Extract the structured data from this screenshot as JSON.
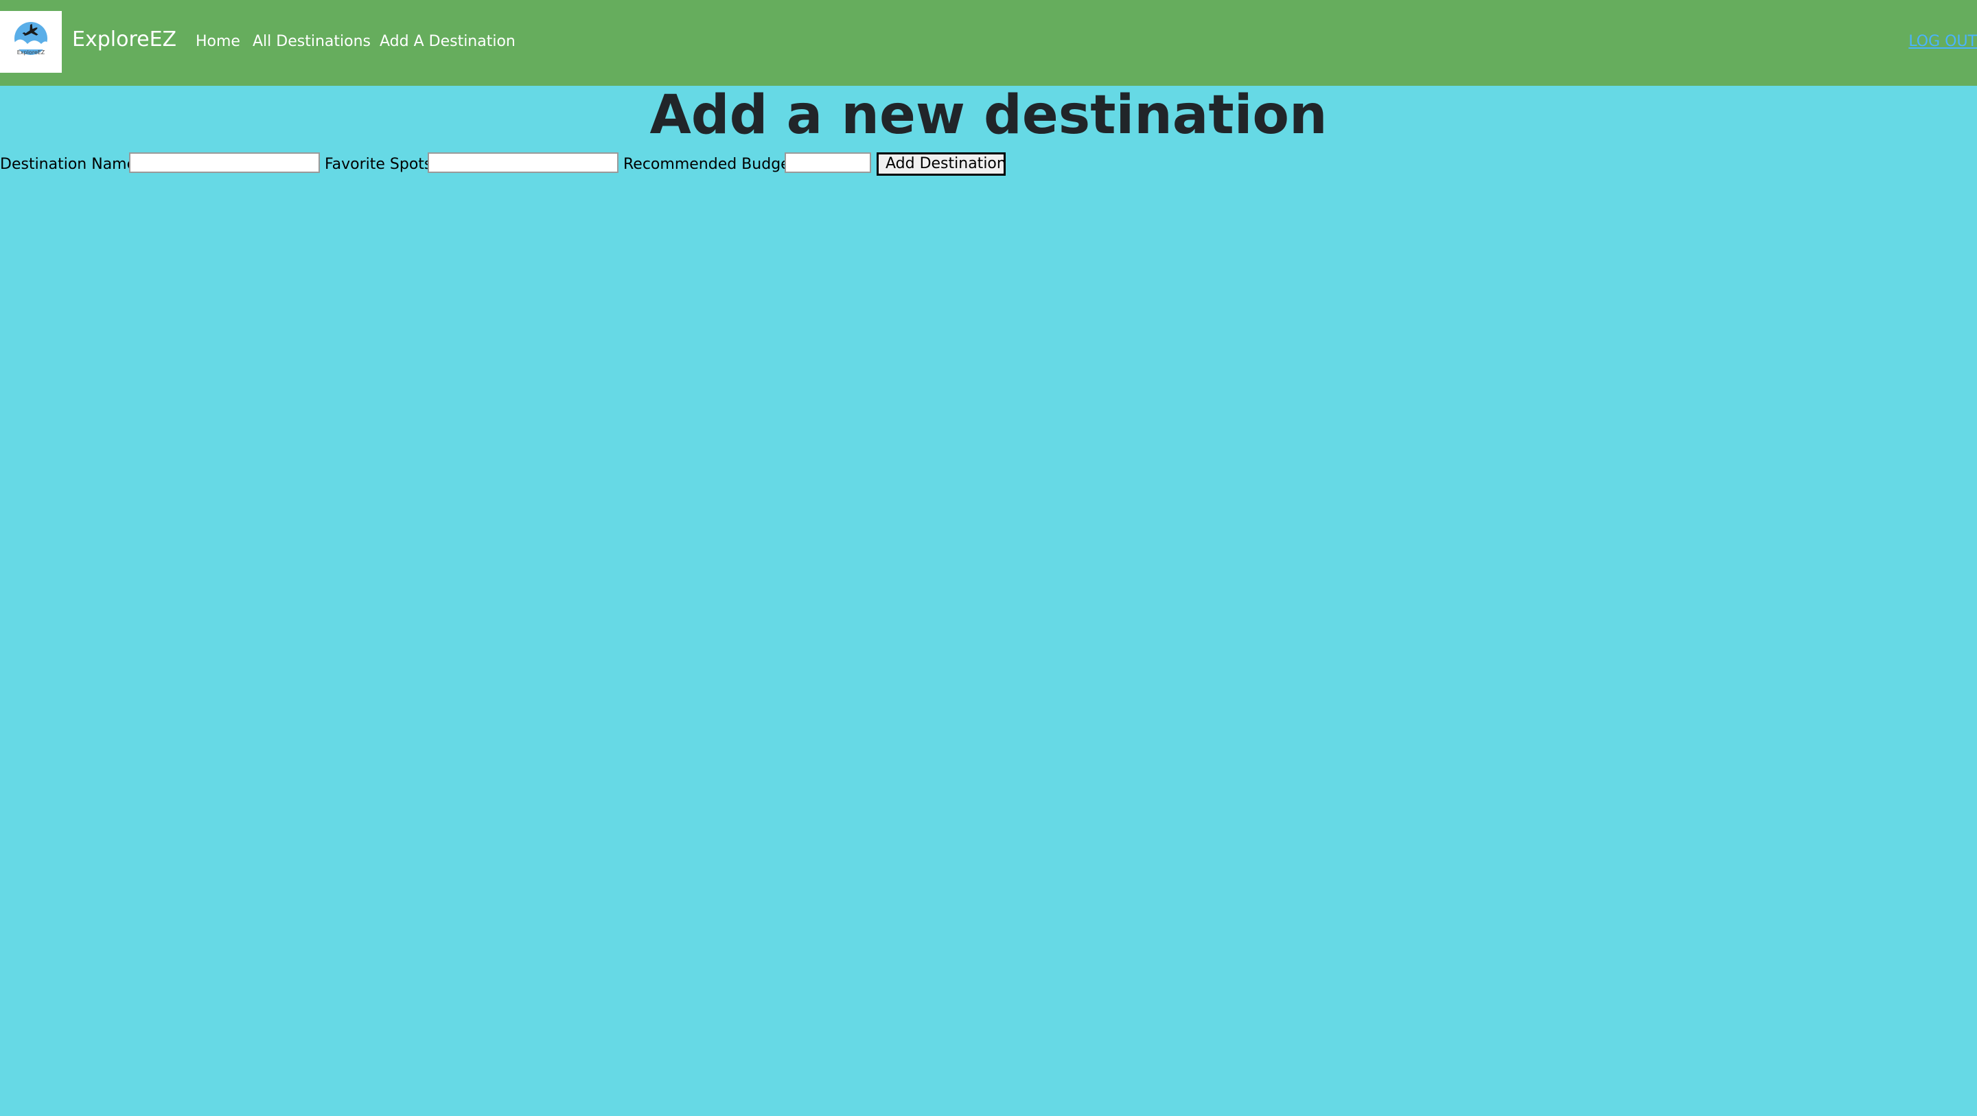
{
  "navbar": {
    "logo_text": "ExploreEZ",
    "brand": "ExploreEZ",
    "links": [
      {
        "label": "Home"
      },
      {
        "label": "All Destinations"
      },
      {
        "label": "Add A Destination"
      }
    ],
    "logout": "LOG OUT",
    "background_color": "#66ad5d",
    "logout_color": "#4ab3ff"
  },
  "page": {
    "title": "Add a new destination",
    "background_color": "#66d9e5"
  },
  "form": {
    "destination_name_label": "Destination Name",
    "destination_name_value": "",
    "favorite_spots_label": "Favorite Spots",
    "favorite_spots_value": "",
    "budget_label": "Recommended Budget",
    "budget_value": "",
    "submit_label": "Add Destination"
  },
  "icons": {
    "logo": "airplane-globe-icon"
  }
}
